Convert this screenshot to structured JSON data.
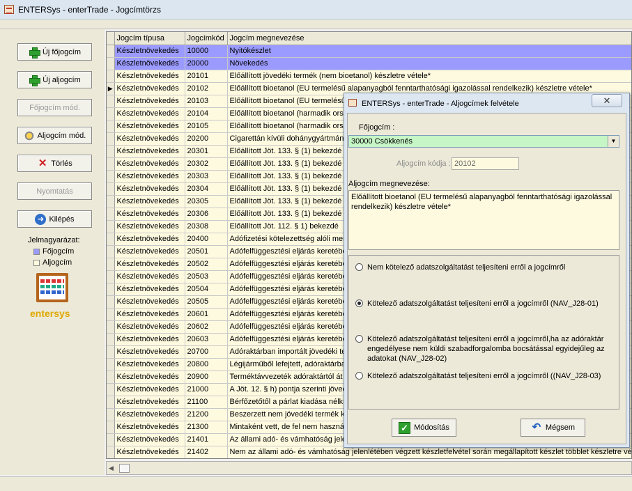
{
  "window": {
    "title": "ENTERSys - enterTrade - Jogcímtörzs"
  },
  "left_panel": {
    "buttons": {
      "new_main": "Új főjogcím",
      "new_sub": "Új aljogcím",
      "edit_main": "Főjogcím mód.",
      "edit_sub": "Aljogcím mód.",
      "delete": "Törlés",
      "print": "Nyomtatás",
      "exit": "Kilépés"
    },
    "legend": {
      "title": "Jelmagyarázat:",
      "main": "Főjogcím",
      "sub": "Aljogcím"
    },
    "logo_text": "entersys"
  },
  "colors": {
    "main_row": "#9b9bff",
    "sub_row": "#fefae0",
    "combo_bg": "#c6f5c6"
  },
  "grid": {
    "columns": [
      "Jogcím típusa",
      "Jogcímkód",
      "Jogcím megnevezése"
    ],
    "rows": [
      {
        "type": "Készletnövekedés",
        "code": "10000",
        "name": "Nyitókészlet",
        "main": true
      },
      {
        "type": "Készletnövekedés",
        "code": "20000",
        "name": "Növekedés",
        "main": true
      },
      {
        "type": "Készletnövekedés",
        "code": "20101",
        "name": "Előállított jövedéki termék (nem bioetanol) készletre vétele*"
      },
      {
        "type": "Készletnövekedés",
        "code": "20102",
        "name": "Előállított  bioetanol (EU termelésű alapanyagból fenntarthatósági igazolással rendelkezik) készletre vétele*",
        "current": true
      },
      {
        "type": "Készletnövekedés",
        "code": "20103",
        "name": "Előállított  bioetanol (EU termelésű"
      },
      {
        "type": "Készletnövekedés",
        "code": "20104",
        "name": "Előállított  bioetanol (harmadik ors"
      },
      {
        "type": "Készletnövekedés",
        "code": "20105",
        "name": "Előállított  bioetanol (harmadik ors"
      },
      {
        "type": "Készletnövekedés",
        "code": "20200",
        "name": "Cigarettán kívüli dohánygyártmány"
      },
      {
        "type": "Készletnövekedés",
        "code": "20301",
        "name": "Előállított Jöt. 133. § (1) bekezdé"
      },
      {
        "type": "Készletnövekedés",
        "code": "20302",
        "name": "Előállított Jöt. 133. § (1) bekezdé"
      },
      {
        "type": "Készletnövekedés",
        "code": "20303",
        "name": "Előállított Jöt. 133. § (1) bekezdé"
      },
      {
        "type": "Készletnövekedés",
        "code": "20304",
        "name": "Előállított Jöt. 133. § (1) bekezdé"
      },
      {
        "type": "Készletnövekedés",
        "code": "20305",
        "name": "Előállított Jöt. 133. § (1) bekezdé"
      },
      {
        "type": "Készletnövekedés",
        "code": "20306",
        "name": "Előállított Jöt. 133. § (1) bekezdé"
      },
      {
        "type": "Készletnövekedés",
        "code": "20308",
        "name": "Előállított Jöt. 112. § 1) bekezdé"
      },
      {
        "type": "Készletnövekedés",
        "code": "20400",
        "name": "Adófizetési kötelezettség alóli men"
      },
      {
        "type": "Készletnövekedés",
        "code": "20501",
        "name": "Adófelfüggesztési eljárás keretébe"
      },
      {
        "type": "Készletnövekedés",
        "code": "20502",
        "name": "Adófelfüggesztési eljárás keretébe"
      },
      {
        "type": "Készletnövekedés",
        "code": "20503",
        "name": "Adófelfüggesztési eljárás keretébe"
      },
      {
        "type": "Készletnövekedés",
        "code": "20504",
        "name": "Adófelfüggesztési eljárás keretébe"
      },
      {
        "type": "Készletnövekedés",
        "code": "20505",
        "name": "Adófelfüggesztési eljárás keretébe"
      },
      {
        "type": "Készletnövekedés",
        "code": "20601",
        "name": "Adófelfüggesztési eljárás keretébe"
      },
      {
        "type": "Készletnövekedés",
        "code": "20602",
        "name": "Adófelfüggesztési eljárás keretébe"
      },
      {
        "type": "Készletnövekedés",
        "code": "20603",
        "name": "Adófelfüggesztési eljárás keretébe"
      },
      {
        "type": "Készletnövekedés",
        "code": "20700",
        "name": "Adóraktárban importált jövedéki te"
      },
      {
        "type": "Készletnövekedés",
        "code": "20800",
        "name": "Légijárműből lefejtett, adóraktárba"
      },
      {
        "type": "Készletnövekedés",
        "code": "20900",
        "name": "Terméktávvezeték adóraktártól át"
      },
      {
        "type": "Készletnövekedés",
        "code": "21000",
        "name": "A Jöt. 12. § h) pontja szerinti jöved"
      },
      {
        "type": "Készletnövekedés",
        "code": "21100",
        "name": "Bérfőzetőtől a párlat kiadása nélkü"
      },
      {
        "type": "Készletnövekedés",
        "code": "21200",
        "name": "Beszerzett nem jövedéki termék k"
      },
      {
        "type": "Készletnövekedés",
        "code": "21300",
        "name": "Mintaként vett, de fel nem haszná"
      },
      {
        "type": "Készletnövekedés",
        "code": "21401",
        "name": "Az állami adó- és vámhatóság jele"
      },
      {
        "type": "Készletnövekedés",
        "code": "21402",
        "name": "Nem az állami adó- és vámhatóság jelenlétében végzett készletfelvétel során megállapított készlet többlet készletre vétele*"
      }
    ]
  },
  "dialog": {
    "title": "ENTERSys - enterTrade - Aljogcímek felvétele",
    "close": "✕",
    "main_label": "Főjogcím :",
    "main_value": "30000 Csökkenés",
    "code_label": "Aljogcím kódja :",
    "code_value": "20102",
    "desc_label": "Aljogcím megnevezése:",
    "desc_value": "Előállított  bioetanol (EU termelésű alapanyagból fenntarthatósági igazolással rendelkezik) készletre vétele*",
    "radios": [
      {
        "label": "Nem kötelező adatszolgáltatást teljesíteni erről a jogcímről",
        "checked": false
      },
      {
        "label": "Kötelező adatszolgáltatást teljesíteni erről a jogcímről (NAV_J28-01)",
        "checked": true
      },
      {
        "label": "Kötelező adatszolgáltatást teljesíteni erről a jogcímről,ha az adóraktár engedélyese nem küldi szabadforgalomba bocsátással egyidejűleg az adatokat (NAV_J28-02)",
        "checked": false
      },
      {
        "label": "Kötelező adatszolgáltatást teljesíteni erről a jogcímről ((NAV_J28-03)",
        "checked": false
      }
    ],
    "ok_label": "Módosítás",
    "cancel_label": "Mégsem"
  }
}
